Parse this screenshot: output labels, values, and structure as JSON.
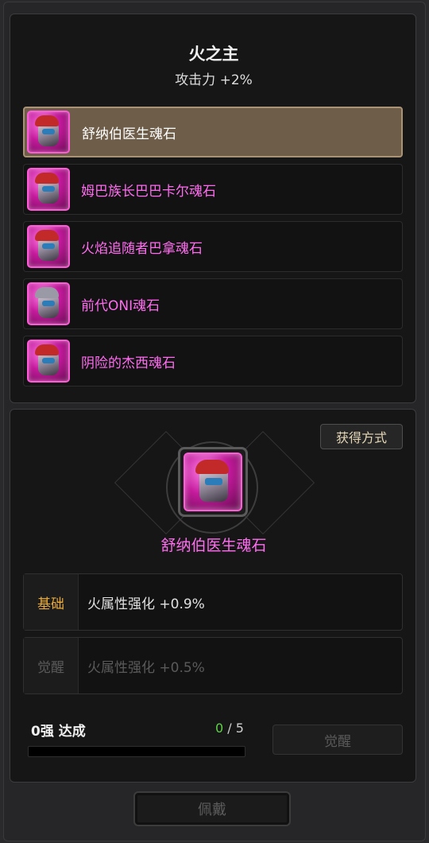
{
  "set": {
    "title": "火之主",
    "bonus": "攻击力 +2%"
  },
  "soulstones": [
    {
      "name": "舒纳伯医生魂石",
      "selected": true
    },
    {
      "name": "姆巴族长巴巴卡尔魂石",
      "selected": false
    },
    {
      "name": "火焰追随者巴拿魂石",
      "selected": false
    },
    {
      "name": "前代ONI魂石",
      "selected": false
    },
    {
      "name": "阴险的杰西魂石",
      "selected": false
    }
  ],
  "detail": {
    "acquire_label": "获得方式",
    "selected_name": "舒纳伯医生魂石",
    "stats": [
      {
        "label": "基础",
        "text": "火属性强化 +0.9%",
        "active": true
      },
      {
        "label": "觉醒",
        "text": "火属性强化 +0.5%",
        "active": false
      }
    ],
    "progress": {
      "title": "0强 达成",
      "current": "0",
      "separator": "/",
      "max": "5",
      "fraction": 0
    },
    "awaken_label": "觉醒"
  },
  "equip_label": "佩戴",
  "colors": {
    "rarity_pink": "#ff6cf0",
    "label_gold": "#e6a93a",
    "progress_green": "#5fd048"
  }
}
